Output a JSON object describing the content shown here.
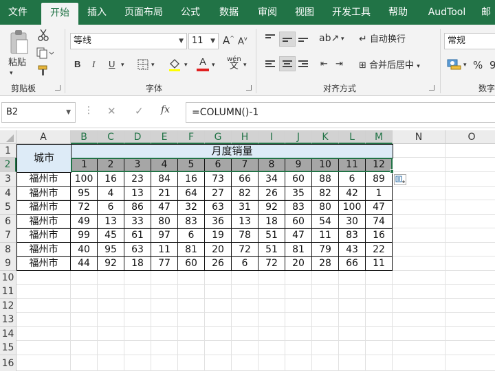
{
  "tabs": [
    "文件",
    "开始",
    "插入",
    "页面布局",
    "公式",
    "数据",
    "审阅",
    "视图",
    "开发工具",
    "帮助",
    "AudTool",
    "邮"
  ],
  "active_tab": "开始",
  "ribbon": {
    "paste_label": "粘贴",
    "clipboard_group": "剪贴板",
    "font_name": "等线",
    "font_size": "11",
    "bold": "B",
    "italic": "I",
    "underline": "U",
    "grow_font": "A",
    "shrink_font": "A",
    "phonetic": "wén",
    "font_color_letter": "A",
    "font_group": "字体",
    "wrap_text": "自动换行",
    "merge_center": "合并后居中",
    "align_group": "对齐方式",
    "number_format": "常规",
    "percent": "%",
    "comma": "9",
    "number_group": "数字"
  },
  "formula_bar": {
    "name_box": "B2",
    "cancel": "✕",
    "enter": "✓",
    "fx": "fx",
    "formula": "=COLUMN()-1"
  },
  "columns": [
    "A",
    "B",
    "C",
    "D",
    "E",
    "F",
    "G",
    "H",
    "I",
    "J",
    "K",
    "L",
    "M",
    "N",
    "O"
  ],
  "rows": [
    "1",
    "2",
    "3",
    "4",
    "5",
    "6",
    "7",
    "8",
    "9",
    "10",
    "11",
    "12",
    "13",
    "14",
    "15",
    "16"
  ],
  "sheet": {
    "a_header": "城市",
    "title": "月度销量",
    "months": [
      "1",
      "2",
      "3",
      "4",
      "5",
      "6",
      "7",
      "8",
      "9",
      "10",
      "11",
      "12"
    ],
    "data": [
      [
        "福州市",
        "100",
        "16",
        "23",
        "84",
        "16",
        "73",
        "66",
        "34",
        "60",
        "88",
        "6",
        "89"
      ],
      [
        "福州市",
        "95",
        "4",
        "13",
        "21",
        "64",
        "27",
        "82",
        "26",
        "35",
        "82",
        "42",
        "1"
      ],
      [
        "福州市",
        "72",
        "6",
        "86",
        "47",
        "32",
        "63",
        "31",
        "92",
        "83",
        "80",
        "100",
        "47"
      ],
      [
        "福州市",
        "49",
        "13",
        "33",
        "80",
        "83",
        "36",
        "13",
        "18",
        "60",
        "54",
        "30",
        "74"
      ],
      [
        "福州市",
        "99",
        "45",
        "61",
        "97",
        "6",
        "19",
        "78",
        "51",
        "47",
        "11",
        "83",
        "16"
      ],
      [
        "福州市",
        "40",
        "95",
        "63",
        "11",
        "81",
        "20",
        "72",
        "51",
        "81",
        "79",
        "43",
        "22"
      ],
      [
        "福州市",
        "44",
        "92",
        "18",
        "77",
        "60",
        "26",
        "6",
        "72",
        "20",
        "28",
        "66",
        "11"
      ]
    ]
  }
}
